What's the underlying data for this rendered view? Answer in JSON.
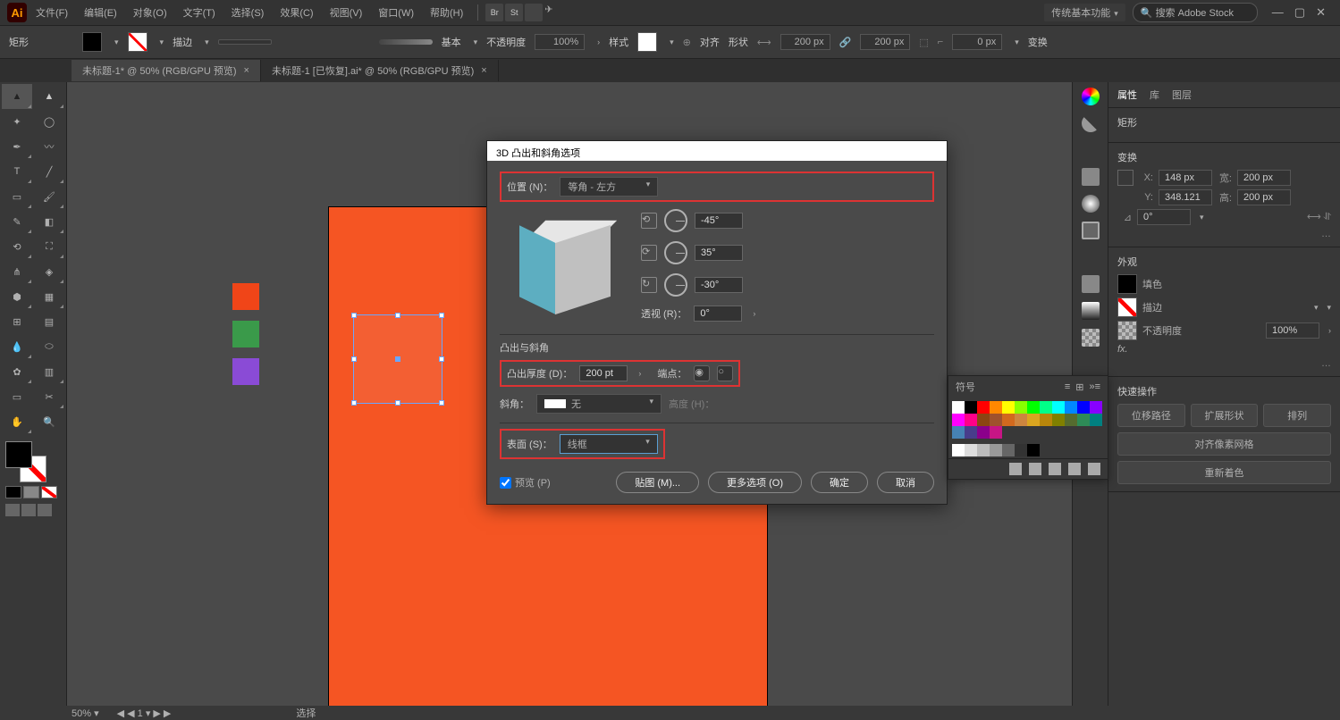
{
  "menubar": {
    "logo": "Ai",
    "items": [
      "文件(F)",
      "编辑(E)",
      "对象(O)",
      "文字(T)",
      "选择(S)",
      "效果(C)",
      "视图(V)",
      "窗口(W)",
      "帮助(H)"
    ],
    "workspace": "传统基本功能",
    "search_placeholder": "搜索 Adobe Stock"
  },
  "controlbar": {
    "shape": "矩形",
    "stroke_label": "描边",
    "stroke_val": "",
    "style_label": "基本",
    "opacity_label": "不透明度",
    "opacity_val": "100%",
    "pattern_label": "样式",
    "align_label": "对齐",
    "shape_label": "形状",
    "w_val": "200 px",
    "h_val": "200 px",
    "x_offset": "0 px",
    "transform_label": "变换"
  },
  "tabs": {
    "active": "未标题-1* @ 50% (RGB/GPU 预览)",
    "inactive": "未标题-1 [已恢复].ai* @ 50% (RGB/GPU 预览)"
  },
  "dialog": {
    "title": "3D 凸出和斜角选项",
    "position_label": "位置 (N)：",
    "position_val": "等角 - 左方",
    "rot_x": "-45°",
    "rot_y": "35°",
    "rot_z": "-30°",
    "perspective_label": "透视 (R)：",
    "perspective_val": "0°",
    "section1": "凸出与斜角",
    "depth_label": "凸出厚度 (D)：",
    "depth_val": "200 pt",
    "cap_label": "端点：",
    "bevel_label": "斜角：",
    "bevel_val": "无",
    "height_label": "高度 (H)：",
    "surface_label": "表面 (S)：",
    "surface_val": "线框",
    "preview_label": "预览 (P)",
    "map_btn": "贴图 (M)...",
    "more_btn": "更多选项 (O)",
    "ok_btn": "确定",
    "cancel_btn": "取消"
  },
  "properties": {
    "tabs": [
      "属性",
      "库",
      "图层"
    ],
    "shape_label": "矩形",
    "transform_label": "变换",
    "x_label": "X:",
    "x_val": "148 px",
    "y_label": "Y:",
    "y_val": "348.121",
    "w_label": "宽:",
    "w_val": "200 px",
    "h_label": "高:",
    "h_val": "200 px",
    "angle_label": "⊿",
    "angle_val": "0°",
    "appearance_label": "外观",
    "fill_label": "填色",
    "stroke_label": "描边",
    "opacity_label": "不透明度",
    "opacity_val": "100%",
    "fx_label": "fx.",
    "quick_label": "快速操作",
    "btns": [
      "位移路径",
      "扩展形状",
      "排列",
      "对齐像素网格",
      "重新着色"
    ]
  },
  "swatches_panel": {
    "title": "符号",
    "colors": [
      "#ffffff",
      "#000000",
      "#ff0000",
      "#ff8800",
      "#ffff00",
      "#88ff00",
      "#00ff00",
      "#00ff88",
      "#00ffff",
      "#0088ff",
      "#0000ff",
      "#8800ff",
      "#ff00ff",
      "#ff0088",
      "#8b4513",
      "#a0522d",
      "#d2691e",
      "#cd853f",
      "#daa520",
      "#b8860b",
      "#808000",
      "#556b2f",
      "#2e8b57",
      "#008080",
      "#4682b4",
      "#483d8b",
      "#8b008b",
      "#c71585"
    ]
  },
  "statusbar": {
    "zoom": "50%",
    "artboard": "1",
    "tool": "选择"
  }
}
